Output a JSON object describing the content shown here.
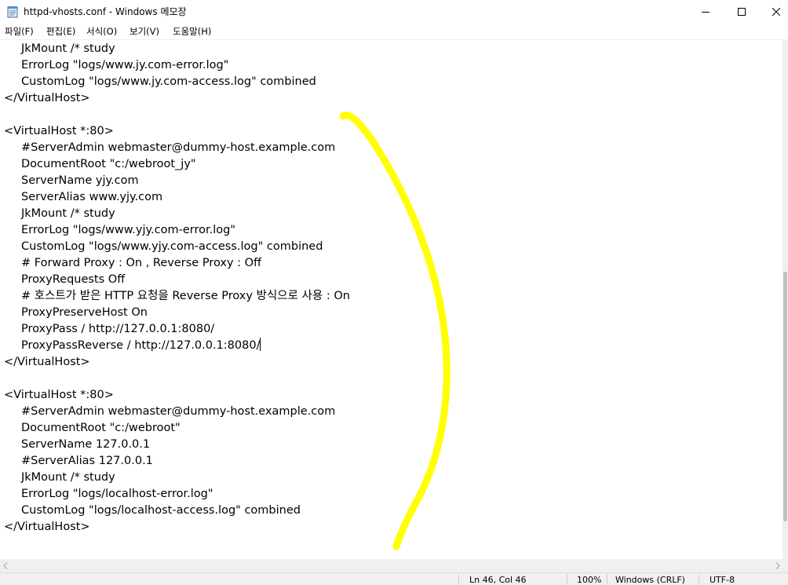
{
  "window": {
    "title": "httpd-vhosts.conf - Windows 메모장"
  },
  "menu": [
    {
      "label": "파일(F)"
    },
    {
      "label": "편집(E)"
    },
    {
      "label": "서식(O)"
    },
    {
      "label": "보기(V)"
    },
    {
      "label": "도움말(H)"
    }
  ],
  "editor": {
    "lines": [
      {
        "text": "JkMount /* study",
        "indent": true
      },
      {
        "text": "ErrorLog \"logs/www.jy.com-error.log\"",
        "indent": true
      },
      {
        "text": "CustomLog \"logs/www.jy.com-access.log\" combined",
        "indent": true
      },
      {
        "text": "</VirtualHost>",
        "indent": false
      },
      {
        "text": "",
        "indent": false
      },
      {
        "text": "<VirtualHost *:80>",
        "indent": false
      },
      {
        "text": "#ServerAdmin webmaster@dummy-host.example.com",
        "indent": true
      },
      {
        "text": "DocumentRoot \"c:/webroot_jy\"",
        "indent": true
      },
      {
        "text": "ServerName yjy.com",
        "indent": true
      },
      {
        "text": "ServerAlias www.yjy.com",
        "indent": true
      },
      {
        "text": "JkMount /* study",
        "indent": true
      },
      {
        "text": "ErrorLog \"logs/www.yjy.com-error.log\"",
        "indent": true
      },
      {
        "text": "CustomLog \"logs/www.yjy.com-access.log\" combined",
        "indent": true
      },
      {
        "text": "# Forward Proxy : On , Reverse Proxy : Off",
        "indent": true
      },
      {
        "text": "ProxyRequests Off",
        "indent": true
      },
      {
        "text": "# 호스트가 받은 HTTP 요청을 Reverse Proxy 방식으로 사용 : On",
        "indent": true
      },
      {
        "text": "ProxyPreserveHost On",
        "indent": true
      },
      {
        "text": "ProxyPass / http://127.0.0.1:8080/",
        "indent": true
      },
      {
        "text": "ProxyPassReverse / http://127.0.0.1:8080/",
        "indent": true,
        "caret": true
      },
      {
        "text": "</VirtualHost>",
        "indent": false
      },
      {
        "text": "",
        "indent": false
      },
      {
        "text": "<VirtualHost *:80>",
        "indent": false
      },
      {
        "text": "#ServerAdmin webmaster@dummy-host.example.com",
        "indent": true
      },
      {
        "text": "DocumentRoot \"c:/webroot\"",
        "indent": true
      },
      {
        "text": "ServerName 127.0.0.1",
        "indent": true
      },
      {
        "text": "#ServerAlias 127.0.0.1",
        "indent": true
      },
      {
        "text": "JkMount /* study",
        "indent": true
      },
      {
        "text": "ErrorLog \"logs/localhost-error.log\"",
        "indent": true
      },
      {
        "text": "CustomLog \"logs/localhost-access.log\" combined",
        "indent": true
      },
      {
        "text": "</VirtualHost>",
        "indent": false
      }
    ]
  },
  "status": {
    "position": "Ln 46, Col 46",
    "zoom": "100%",
    "line_ending": "Windows (CRLF)",
    "encoding": "UTF-8"
  },
  "colors": {
    "annotation": "#ffff00",
    "chrome": "#f0f0f0"
  },
  "icons": {
    "app": "notepad-icon",
    "minimize": "minimize-icon",
    "maximize": "maximize-icon",
    "close": "close-icon"
  }
}
